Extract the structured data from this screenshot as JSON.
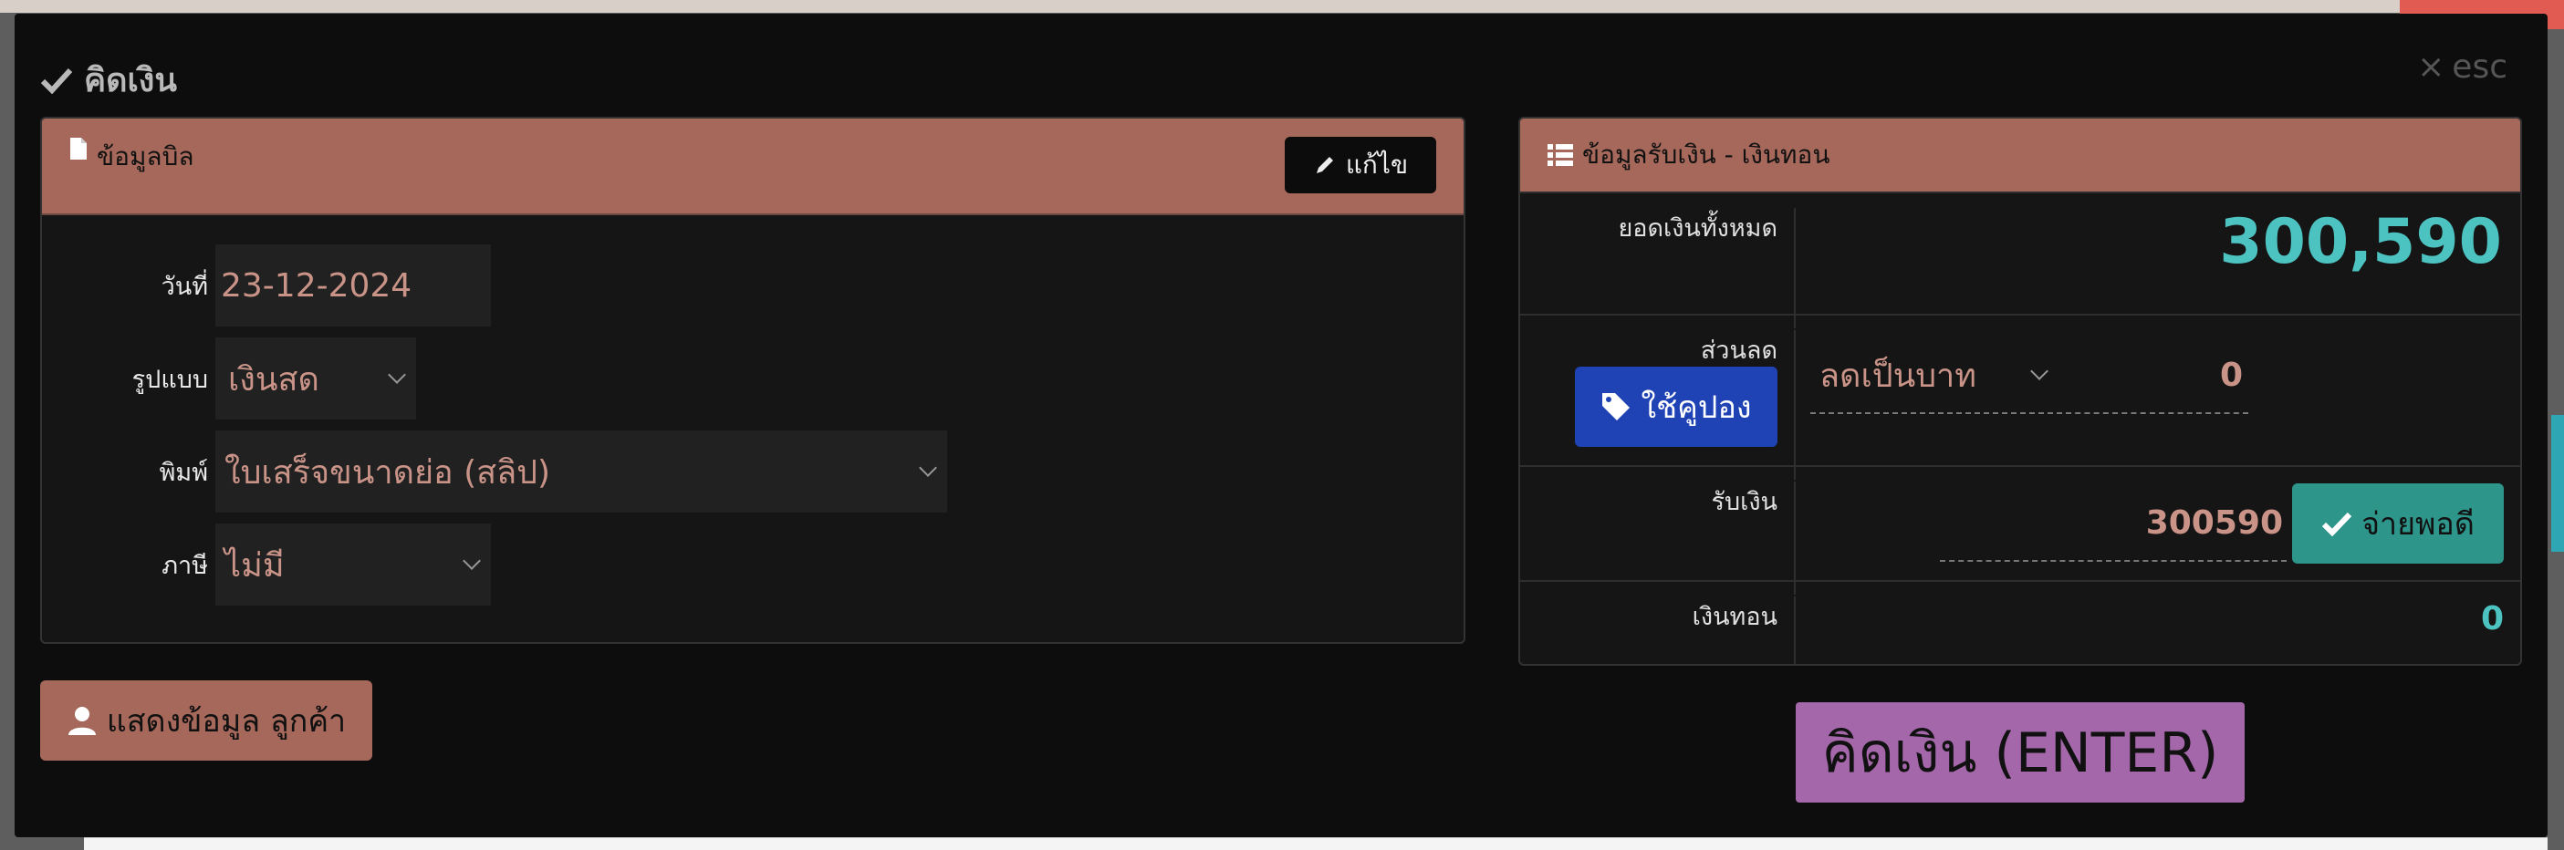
{
  "modal": {
    "title": "คิดเงิน",
    "close_label": "esc"
  },
  "bill_panel": {
    "header": "ข้อมูลบิล",
    "edit_label": "แก้ไข",
    "date_label": "วันที่",
    "date_value": "23-12-2024",
    "format_label": "รูปแบบ",
    "format_value": "เงินสด",
    "print_label": "พิมพ์",
    "print_value": "ใบเสร็จขนาดย่อ (สลิป)",
    "tax_label": "ภาษี",
    "tax_value": "ไม่มี"
  },
  "customer_button": "แสดงข้อมูล ลูกค้า",
  "payment_panel": {
    "header": "ข้อมูลรับเงิน - เงินทอน",
    "total_label": "ยอดเงินทั้งหมด",
    "total_value": "300,590",
    "discount_label": "ส่วนลด",
    "coupon_label": "ใช้คูปอง",
    "discount_type": "ลดเป็นบาท",
    "discount_value": "0",
    "received_label": "รับเงิน",
    "received_value": "300590",
    "exact_label": "จ่ายพอดี",
    "change_label": "เงินทอน",
    "change_value": "0"
  },
  "checkout_button": "คิดเงิน (ENTER)",
  "icons": {
    "title": "check-icon",
    "close": "close-icon",
    "bill_header": "document-icon",
    "edit": "pencil-icon",
    "customer": "user-icon",
    "pay_header": "list-icon",
    "coupon": "tag-icon",
    "exact": "check-icon"
  },
  "colors": {
    "accent": "#a6685a",
    "teal": "#2e958a",
    "total": "#4cc3c0",
    "coupon": "#1f43b5",
    "checkout": "#a467aa"
  }
}
